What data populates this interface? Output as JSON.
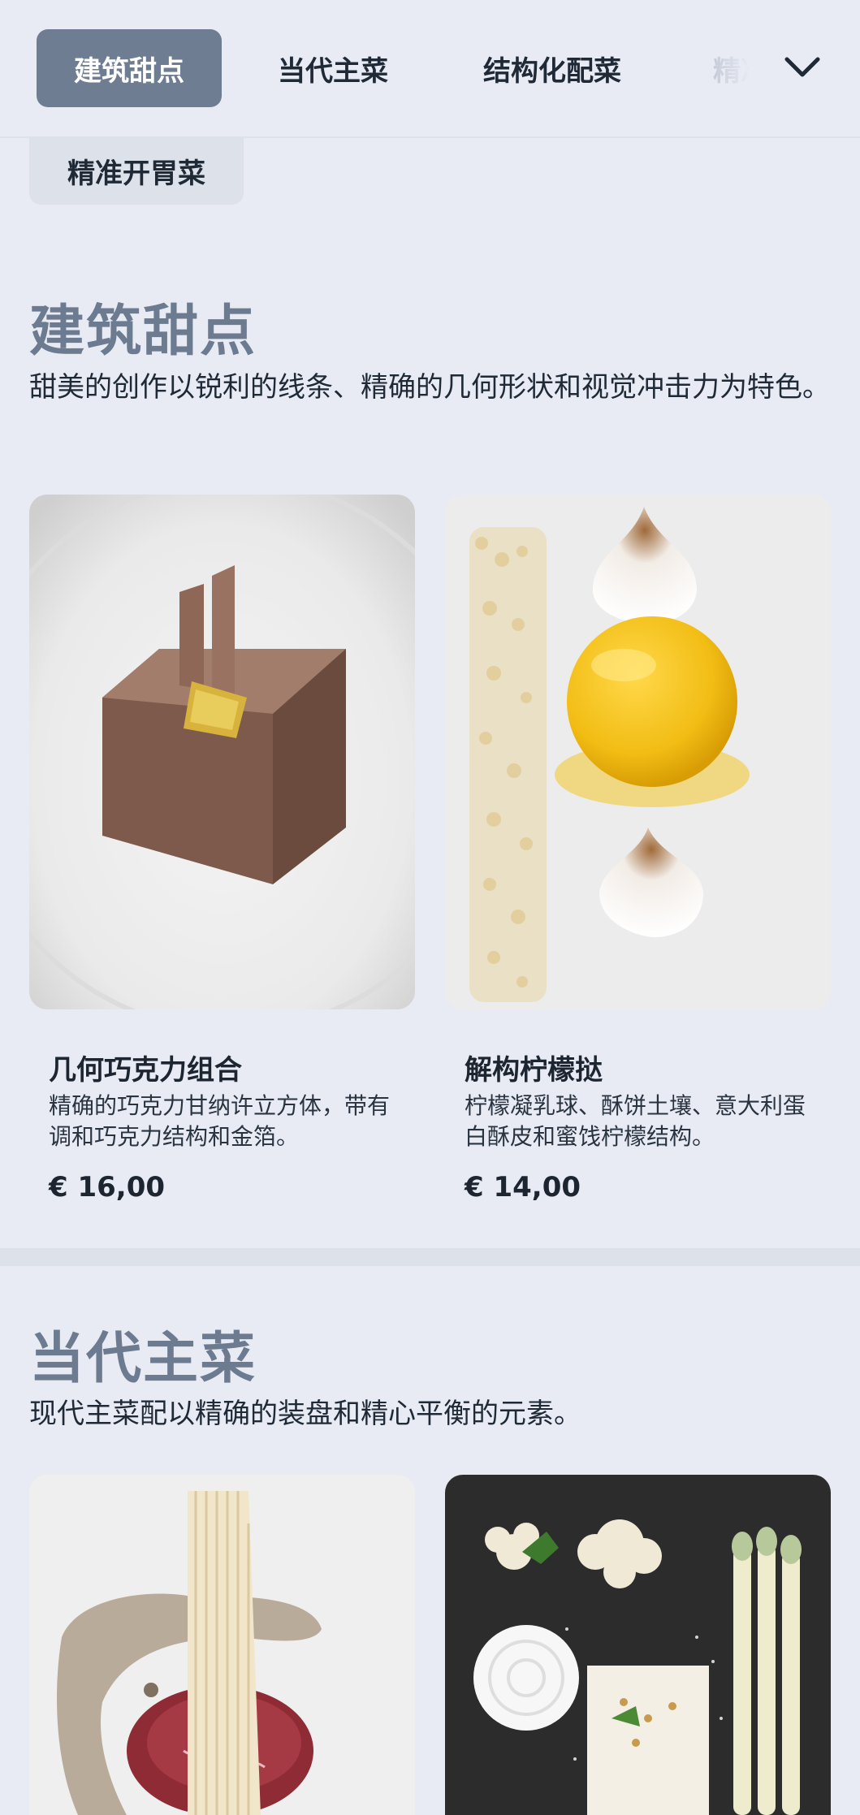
{
  "nav": {
    "tabs": [
      {
        "label": "建筑甜点",
        "active": true
      },
      {
        "label": "当代主菜",
        "active": false
      },
      {
        "label": "结构化配菜",
        "active": false
      },
      {
        "label": "精准开胃菜",
        "active": false
      }
    ],
    "overflow_label": "精准开胃菜",
    "expand_icon": "chevron-down-icon"
  },
  "sections": [
    {
      "title": "建筑甜点",
      "description": "甜美的创作以锐利的线条、精确的几何形状和视觉冲击力为特色。",
      "dishes": [
        {
          "name": "几何巧克力组合",
          "description": "精确的巧克力甘纳许立方体，带有调和巧克力结构和金箔。",
          "price": "€ 16,00",
          "image": "chocolate-cube-photo"
        },
        {
          "name": "解构柠檬挞",
          "description": "柠檬凝乳球、酥饼土壤、意大利蛋白酥皮和蜜饯柠檬结构。",
          "price": "€ 14,00",
          "image": "lemon-tart-photo"
        }
      ]
    },
    {
      "title": "当代主菜",
      "description": "现代主菜配以精确的装盘和精心平衡的元素。",
      "dishes": [
        {
          "image": "beef-tenderloin-photo"
        },
        {
          "image": "cauliflower-asparagus-photo"
        }
      ]
    }
  ],
  "colors": {
    "background": "#e8ebf4",
    "active_tab": "#6e7d92",
    "section_title": "#6c7b90"
  }
}
